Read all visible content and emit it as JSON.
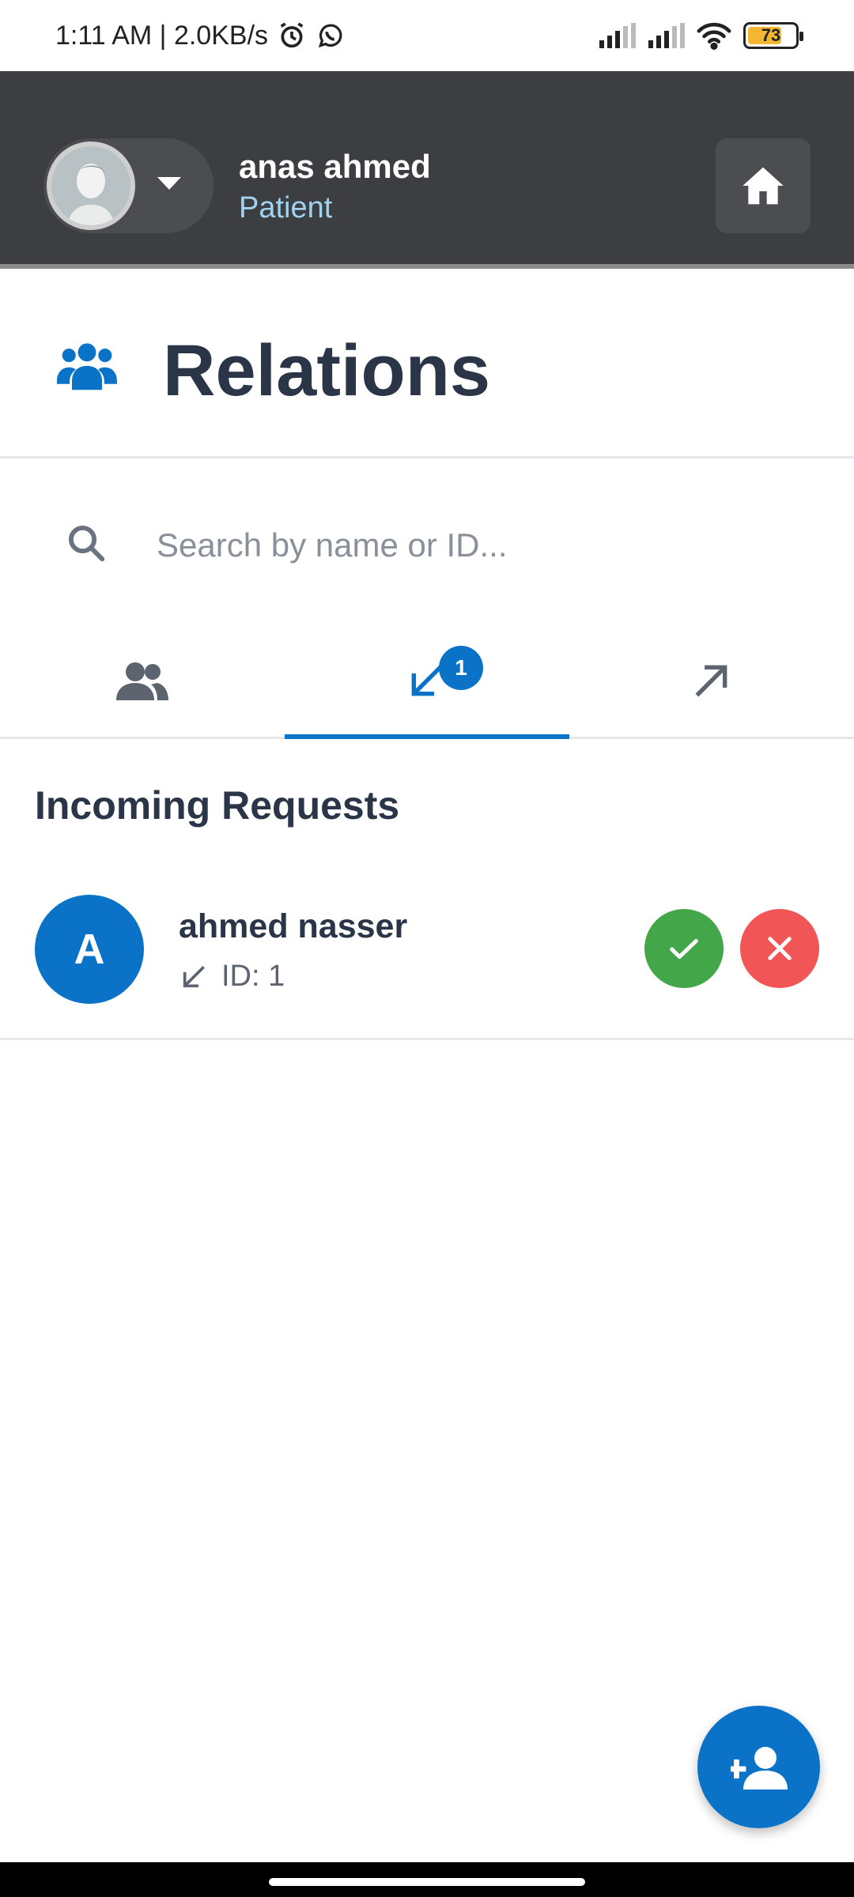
{
  "status_bar": {
    "time_text": "1:11 AM | 2.0KB/s",
    "battery_level": "73",
    "battery_fraction": 0.73,
    "icons": [
      "alarm-icon",
      "whatsapp-icon",
      "signal-icon",
      "signal-icon",
      "wifi-icon",
      "battery-icon"
    ]
  },
  "header": {
    "user_name": "anas ahmed",
    "user_role": "Patient",
    "icons": [
      "avatar-icon",
      "caret-down-icon",
      "home-icon"
    ]
  },
  "page": {
    "title": "Relations",
    "title_icon": "users-icon"
  },
  "search": {
    "placeholder": "Search by name or ID...",
    "value": ""
  },
  "tabs": [
    {
      "name": "relations",
      "icon": "users-icon",
      "active": false
    },
    {
      "name": "incoming",
      "icon": "arrow-down-left-icon",
      "active": true,
      "badge": "1"
    },
    {
      "name": "outgoing",
      "icon": "arrow-up-right-icon",
      "active": false
    }
  ],
  "incoming": {
    "section_title": "Incoming Requests",
    "requests": [
      {
        "initial": "A",
        "name": "ahmed nasser",
        "id_text": "ID: 1"
      }
    ]
  },
  "fab": {
    "icon": "add-user-icon"
  },
  "colors": {
    "header_bg": "#3d3e41",
    "accent": "#0a73c8",
    "accept": "#43a648",
    "reject": "#f25555",
    "text_dark": "#2a3547",
    "role_text": "#9fd3ef"
  }
}
